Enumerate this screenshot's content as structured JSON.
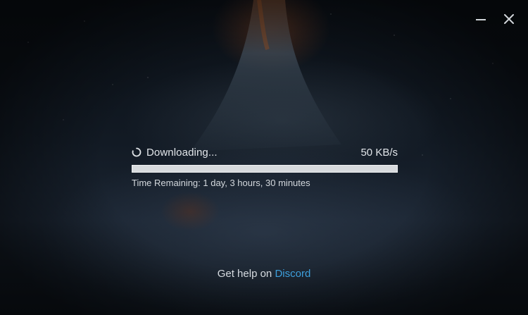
{
  "window_controls": {
    "minimize_icon": "minimize-icon",
    "close_icon": "close-icon"
  },
  "download": {
    "status": "Downloading...",
    "speed": "50 KB/s",
    "progress_fraction": 0.0,
    "time_remaining": "Time Remaining: 1 day, 3 hours, 30 minutes",
    "spinner_icon": "loading-spinner-icon"
  },
  "help": {
    "prefix": "Get help on ",
    "link_text": "Discord"
  },
  "colors": {
    "link": "#3d9fdc",
    "progress_track": "#d7dadd",
    "text": "#e2e6ea"
  }
}
